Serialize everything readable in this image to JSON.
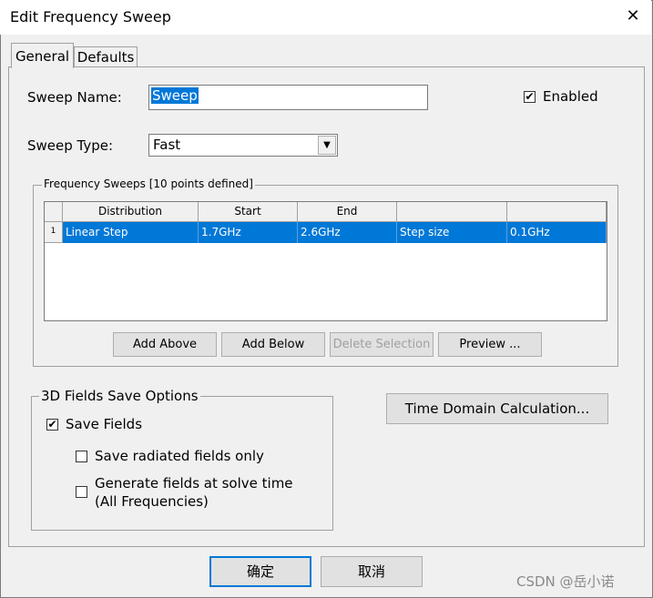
{
  "window": {
    "title": "Edit Frequency Sweep"
  },
  "tabs": [
    {
      "label": "General"
    },
    {
      "label": "Defaults"
    }
  ],
  "general": {
    "sweep_name_label": "Sweep Name:",
    "sweep_name_value": "Sweep",
    "enabled_label": "Enabled",
    "enabled_checked": true,
    "sweep_type_label": "Sweep Type:",
    "sweep_type_value": "Fast"
  },
  "frequency_sweeps": {
    "group_label": "Frequency Sweeps [10 points defined]",
    "columns": [
      "Distribution",
      "Start",
      "End",
      "",
      ""
    ],
    "rows": [
      {
        "index": "1",
        "distribution": "Linear Step",
        "start": "1.7GHz",
        "end": "2.6GHz",
        "param": "Step size",
        "value": "0.1GHz"
      }
    ],
    "buttons": {
      "add_above": "Add Above",
      "add_below": "Add Below",
      "delete_selection": "Delete Selection",
      "preview": "Preview ..."
    }
  },
  "fields_save": {
    "group_label": "3D Fields Save Options",
    "save_fields": "Save Fields",
    "save_fields_checked": true,
    "save_radiated": "Save radiated fields only",
    "generate_line1": "Generate fields at solve time",
    "generate_line2": "(All Frequencies)"
  },
  "time_domain_button": "Time Domain Calculation...",
  "footer": {
    "ok": "确定",
    "cancel": "取消"
  },
  "watermark": "CSDN @岳小诺"
}
